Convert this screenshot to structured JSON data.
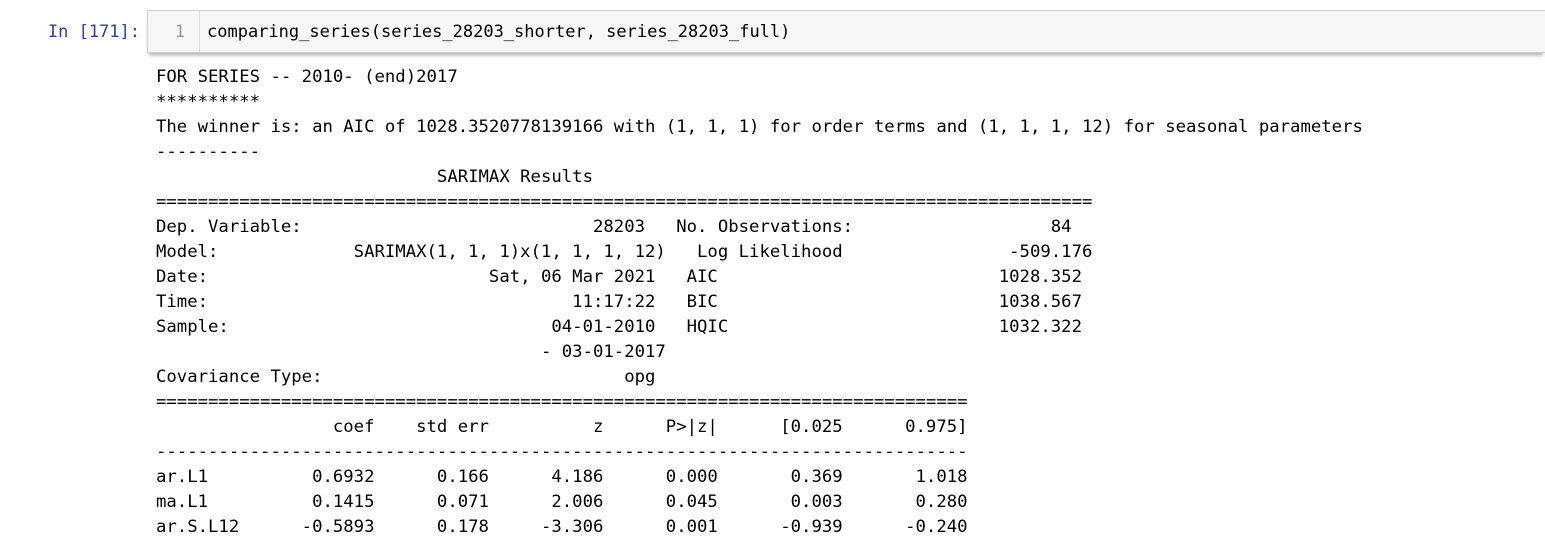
{
  "cell": {
    "prompt": "In [171]:",
    "line_number": "1",
    "code": "comparing_series(series_28203_shorter, series_28203_full)"
  },
  "output": {
    "lines": [
      "FOR SERIES -- 2010- (end)2017",
      "**********",
      "The winner is: an AIC of 1028.3520778139166 with (1, 1, 1) for order terms and (1, 1, 1, 12) for seasonal parameters",
      "----------",
      "                           SARIMAX Results",
      "==========================================================================================",
      "Dep. Variable:                            28203   No. Observations:                   84",
      "Model:             SARIMAX(1, 1, 1)x(1, 1, 1, 12)   Log Likelihood                -509.176",
      "Date:                           Sat, 06 Mar 2021   AIC                           1028.352",
      "Time:                                   11:17:22   BIC                           1038.567",
      "Sample:                               04-01-2010   HQIC                          1032.322",
      "                                     - 03-01-2017",
      "Covariance Type:                             opg",
      "==============================================================================",
      "                 coef    std err          z      P>|z|      [0.025      0.975]",
      "------------------------------------------------------------------------------",
      "ar.L1          0.6932      0.166      4.186      0.000       0.369       1.018",
      "ma.L1          0.1415      0.071      2.006      0.045       0.003       0.280",
      "ar.S.L12      -0.5893      0.178     -3.306      0.001      -0.939      -0.240"
    ]
  }
}
